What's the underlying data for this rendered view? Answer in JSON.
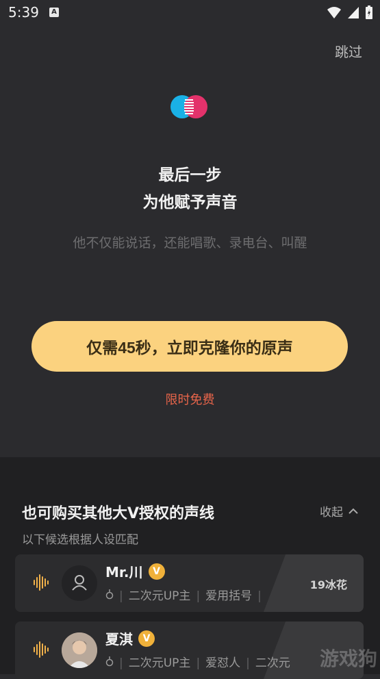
{
  "status_bar": {
    "time": "5:39",
    "notif": "A"
  },
  "header": {
    "skip_label": "跳过"
  },
  "hero": {
    "title_line1": "最后一步",
    "title_line2": "为他赋予声音",
    "subtitle": "他不仅能说话，还能唱歌、录电台、叫醒"
  },
  "cta": {
    "label": "仅需45秒，立即克隆你的原声",
    "free_label": "限时免费"
  },
  "colors": {
    "accent": "#fbd27f",
    "free_text": "#e8654a",
    "badge": "#f0b13a"
  },
  "voice_section": {
    "title": "也可购买其他大V授权的声线",
    "collapse_label": "收起",
    "subtitle": "以下候选根据人设匹配",
    "items": [
      {
        "name": "Mr.川",
        "verified": "V",
        "tags": [
          "二次元UP主",
          "爱用括号"
        ],
        "price": "19冰花",
        "avatar": "person-placeholder-icon"
      },
      {
        "name": "夏淇",
        "verified": "V",
        "tags": [
          "二次元UP主",
          "爱怼人",
          "二次元"
        ],
        "price": "",
        "avatar": "user-photo"
      }
    ]
  },
  "watermark": "游戏狗"
}
